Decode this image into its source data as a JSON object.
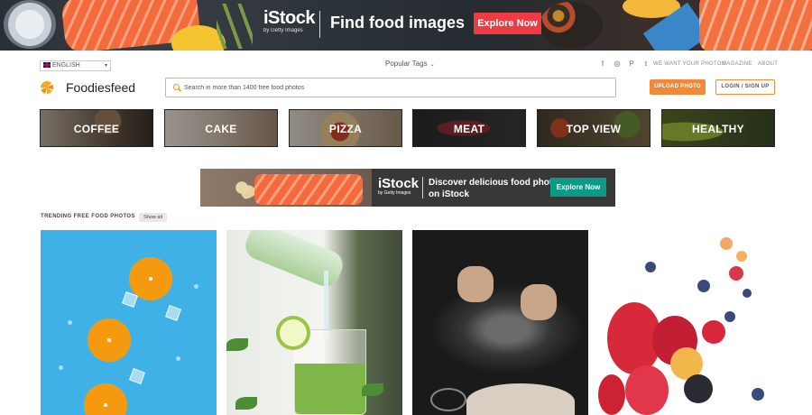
{
  "top_banner": {
    "brand": "iStock",
    "brand_sub": "by Getty Images",
    "headline": "Find food images",
    "cta": "Explore Now"
  },
  "utility_bar": {
    "language": "ENGLISH",
    "popular_tags": "Popular Tags",
    "social_icons": [
      "facebook-icon",
      "instagram-icon",
      "pinterest-icon",
      "twitter-icon"
    ],
    "links": [
      "WE WANT YOUR PHOTOS",
      "MAGAZINE",
      "ABOUT"
    ]
  },
  "header": {
    "site_name": "Foodiesfeed",
    "search_placeholder": "Search in more than 1400 free food photos",
    "upload_label": "UPLOAD PHOTO",
    "login_label": "LOGIN / SIGN UP"
  },
  "categories": [
    {
      "label": "COFFEE"
    },
    {
      "label": "CAKE"
    },
    {
      "label": "PIZZA"
    },
    {
      "label": "MEAT"
    },
    {
      "label": "TOP VIEW"
    },
    {
      "label": "HEALTHY"
    }
  ],
  "mid_ad": {
    "brand": "iStock",
    "brand_sub": "by Getty Images",
    "headline": "Discover delicious food photos on iStock",
    "cta": "Explore Now"
  },
  "trending": {
    "title": "TRENDING FREE FOOD PHOTOS",
    "show_all": "Show all"
  },
  "colors": {
    "accent_orange": "#f08a3a",
    "banner_cta_red": "#ef3b44",
    "ad_cta_teal": "#0c9a86"
  }
}
